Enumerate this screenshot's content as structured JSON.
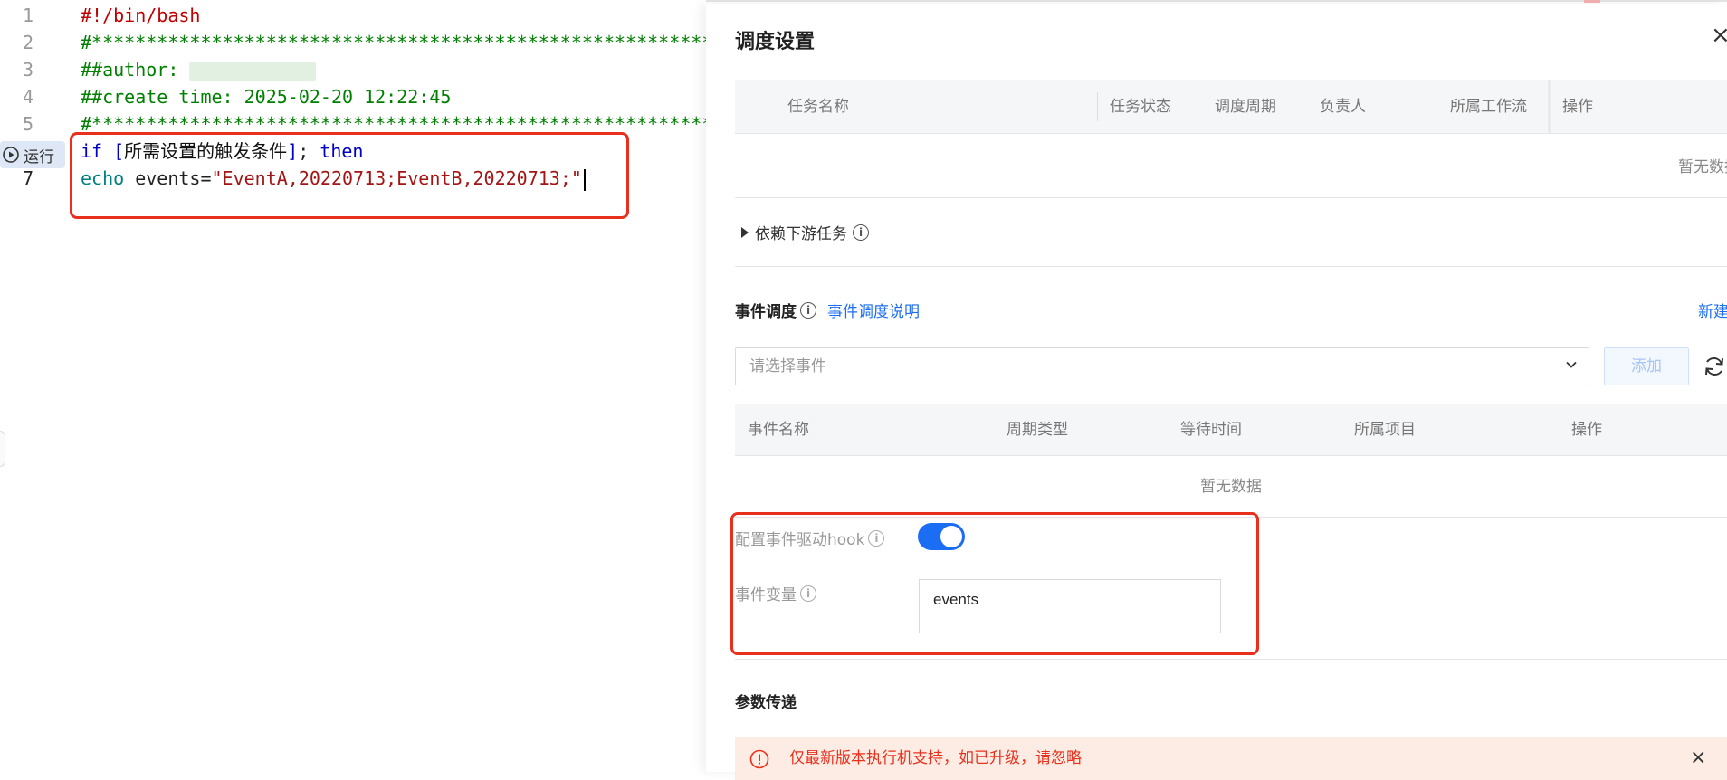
{
  "editor": {
    "lines": [
      {
        "num": "1",
        "parts": [
          {
            "cls": "c-red",
            "text": "#!/bin/bash"
          }
        ]
      },
      {
        "num": "2",
        "parts": [
          {
            "cls": "c-green",
            "text": "#*********************************************************"
          }
        ]
      },
      {
        "num": "3",
        "parts": [
          {
            "cls": "c-green",
            "text": "##author: "
          },
          {
            "cls": "blur",
            "text": ""
          }
        ]
      },
      {
        "num": "4",
        "parts": [
          {
            "cls": "c-green",
            "text": "##create time: 2025-02-20 12:22:45"
          }
        ]
      },
      {
        "num": "5",
        "parts": [
          {
            "cls": "c-green",
            "text": "#*********************************************************"
          }
        ]
      },
      {
        "num": "",
        "parts": [
          {
            "cls": "c-blue",
            "text": "if ["
          },
          {
            "cls": "c-cn",
            "text": "所需设置的触发条件"
          },
          {
            "cls": "c-blue",
            "text": "]"
          },
          {
            "cls": "c-dark",
            "text": "; "
          },
          {
            "cls": "c-blue",
            "text": "then"
          }
        ]
      },
      {
        "num": "7",
        "parts": [
          {
            "cls": "c-teal",
            "text": "echo "
          },
          {
            "cls": "c-dark",
            "text": "events="
          },
          {
            "cls": "c-str",
            "text": "\"EventA,20220713;EventB,20220713;\""
          },
          {
            "cls": "cursor",
            "text": ""
          }
        ]
      }
    ],
    "run_label": "运行"
  },
  "drawer": {
    "title": "调度设置",
    "close": "×",
    "upstream_table": {
      "columns": [
        "任务名称",
        "任务状态",
        "调度周期",
        "负责人",
        "所属工作流",
        "操作"
      ],
      "empty": "暂无数据"
    },
    "downstream_label": "依赖下游任务",
    "event_section": {
      "title": "事件调度",
      "doc_link": "事件调度说明",
      "new_event": "新建事件",
      "select_placeholder": "请选择事件",
      "add_button": "添加",
      "table": {
        "columns": [
          "事件名称",
          "周期类型",
          "等待时间",
          "所属项目",
          "操作"
        ],
        "empty": "暂无数据"
      },
      "hook_label": "配置事件驱动hook",
      "hook_enabled": true,
      "var_label": "事件变量",
      "var_value": "events"
    },
    "param_title": "参数传递",
    "warning": "仅最新版本执行机支持，如已升级，请忽略",
    "warning_close": "×"
  },
  "colors": {
    "accent": "#1b6ef3",
    "highlight": "#e8301c"
  }
}
